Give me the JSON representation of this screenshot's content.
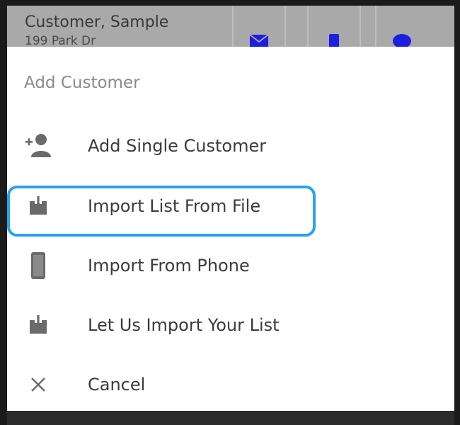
{
  "background_row": {
    "name": "Customer, Sample",
    "address": "199 Park Dr",
    "actions": [
      {
        "icon": "mail-icon",
        "color": "#1e1ee0"
      },
      {
        "icon": "phone-icon",
        "color": "#1e1ee0"
      },
      {
        "icon": "chat-bubble-icon",
        "color": "#1e1ee0"
      }
    ]
  },
  "sheet": {
    "title": "Add Customer",
    "items": [
      {
        "label": "Add Single Customer",
        "icon": "add-person-icon"
      },
      {
        "label": "Import List From File",
        "icon": "download-tray-icon",
        "highlighted": true
      },
      {
        "label": "Import From Phone",
        "icon": "smartphone-icon"
      },
      {
        "label": "Let Us Import Your List",
        "icon": "download-tray-icon"
      },
      {
        "label": "Cancel",
        "icon": "close-icon"
      }
    ]
  },
  "colors": {
    "highlight": "#27a3ef",
    "icon": "#6a6a6a",
    "label": "#3b3b3b",
    "title": "#8a8a8a",
    "action_icon": "#1e1ee0"
  }
}
